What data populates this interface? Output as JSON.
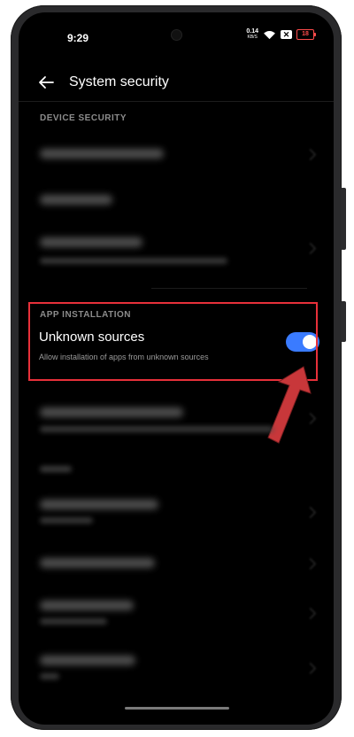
{
  "status_bar": {
    "time": "9:29",
    "speed_value": "0.14",
    "speed_unit": "KB/S",
    "x_badge": "✕",
    "battery": "18"
  },
  "header": {
    "back_icon": "arrow-left-icon",
    "title": "System security"
  },
  "sections": {
    "device_security_label": "DEVICE SECURITY",
    "app_installation_label": "APP INSTALLATION"
  },
  "unknown_sources": {
    "title": "Unknown sources",
    "subtitle": "Allow installation of apps from unknown sources",
    "enabled": true
  },
  "colors": {
    "toggle_on": "#3a7bff",
    "highlight": "#e8303a",
    "arrow": "#c8373a"
  }
}
